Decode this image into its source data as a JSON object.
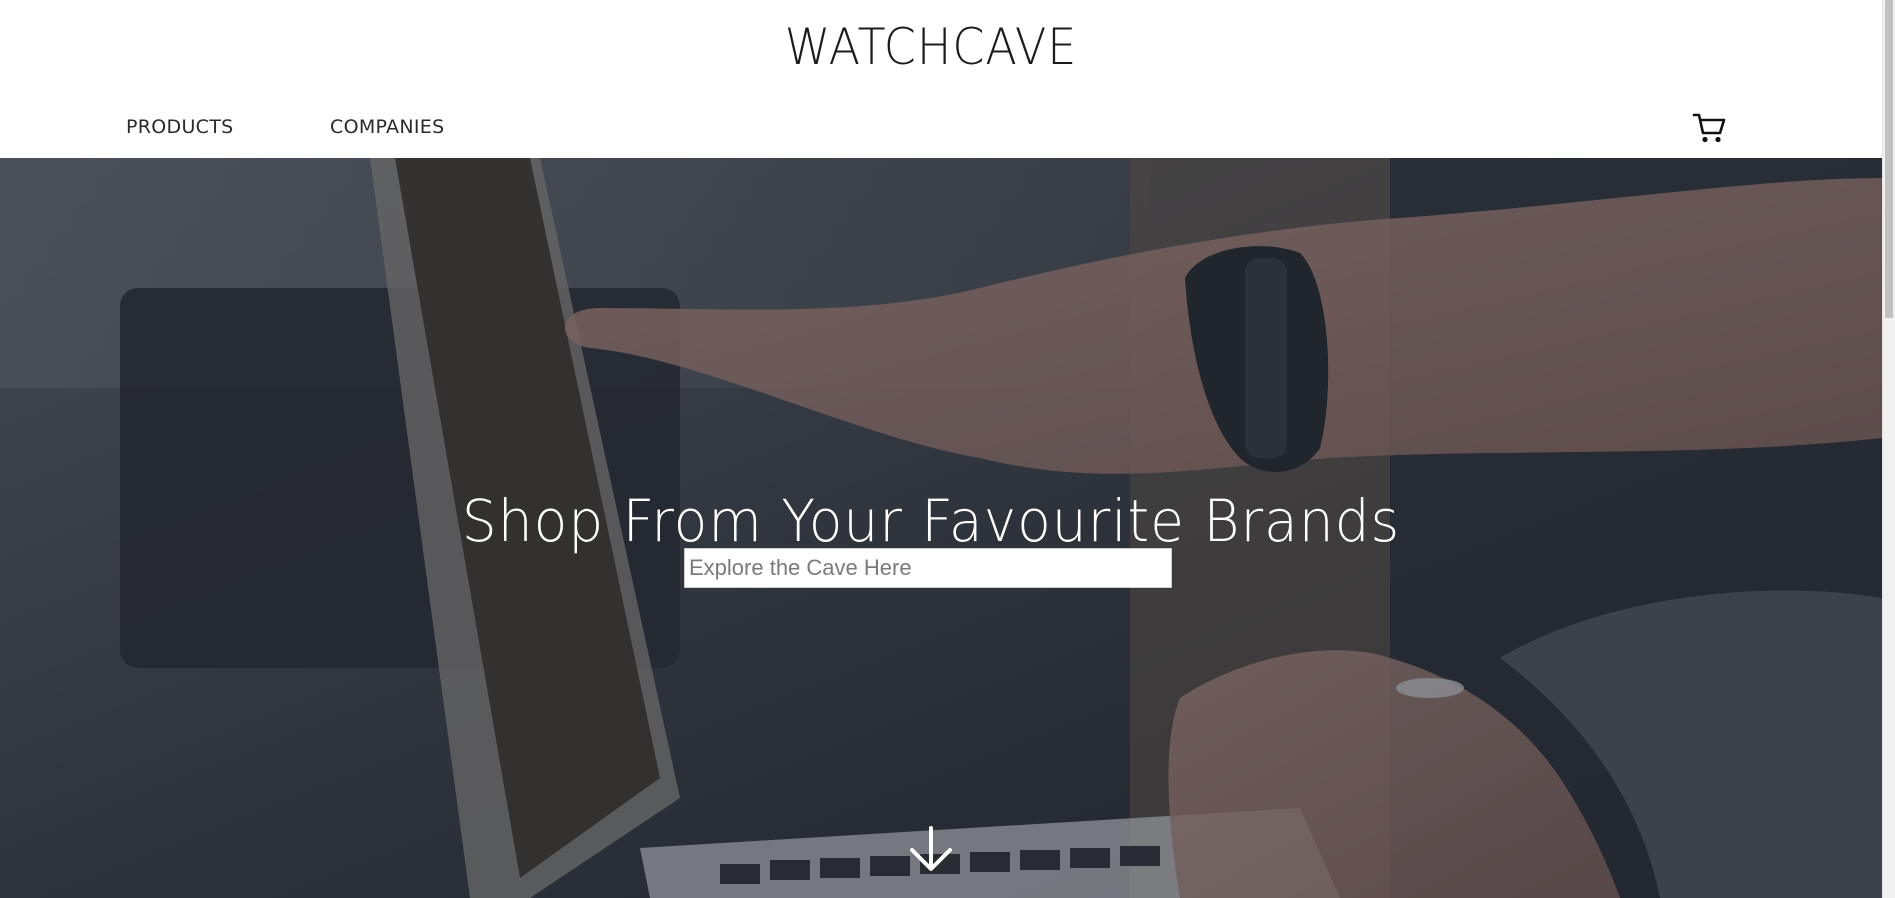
{
  "header": {
    "brand": "WATCHCAVE",
    "nav": {
      "products_label": "PRODUCTS",
      "companies_label": "COMPANIES"
    },
    "cart_icon": "cart-icon"
  },
  "hero": {
    "title": "Shop From Your Favourite Brands",
    "search": {
      "placeholder": "Explore the Cave Here",
      "value": ""
    },
    "scroll_icon": "arrow-down-icon"
  },
  "colors": {
    "header_bg": "#ffffff",
    "text_dark": "#1c1c1c",
    "hero_text": "#ffffff",
    "hero_overlay": "#2b3038"
  }
}
